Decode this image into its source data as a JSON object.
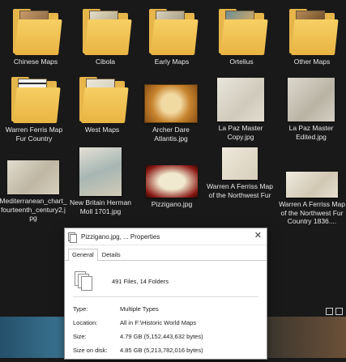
{
  "items": [
    {
      "label": "Chinese Maps",
      "type": "folder"
    },
    {
      "label": "Cibola",
      "type": "folder"
    },
    {
      "label": "Early Maps",
      "type": "folder"
    },
    {
      "label": "Ortelius",
      "type": "folder"
    },
    {
      "label": "Other Maps",
      "type": "folder"
    },
    {
      "label": "Warren Ferris Map Fur Country",
      "type": "folder"
    },
    {
      "label": "West Maps",
      "type": "folder"
    },
    {
      "label": "Archer Dare Atlantis.jpg",
      "type": "image"
    },
    {
      "label": "La Paz Master Copy.jpg",
      "type": "image"
    },
    {
      "label": "La Paz Master Edited.jpg",
      "type": "image"
    },
    {
      "label": "Mediterranean_chart_fourteenth_century2.jpg",
      "type": "image"
    },
    {
      "label": "New Britain Herman Moll 1701.jpg",
      "type": "image"
    },
    {
      "label": "Pizzigano.jpg",
      "type": "image"
    },
    {
      "label": "Warren A Ferriss Map of the Northwest Fur",
      "type": "image"
    },
    {
      "label": "Warren A Ferriss Map of the Northwest Fur Country 1836....",
      "type": "image"
    }
  ],
  "dialog": {
    "title": "Pizzigano.jpg, ... Properties",
    "close": "✕",
    "tabs": [
      "General",
      "Details"
    ],
    "summary": "491 Files, 14 Folders",
    "rows": [
      {
        "key": "Type:",
        "value": "Multiple Types"
      },
      {
        "key": "Location:",
        "value": "All in F:\\Historic World Maps"
      },
      {
        "key": "Size:",
        "value": "4.79 GB (5,152,443,632 bytes)"
      },
      {
        "key": "Size on disk:",
        "value": "4.85 GB (5,213,782,016 bytes)"
      }
    ]
  },
  "colors": {
    "background": "#191919",
    "folder": "#e7b64a",
    "text": "#e8e8e8"
  }
}
